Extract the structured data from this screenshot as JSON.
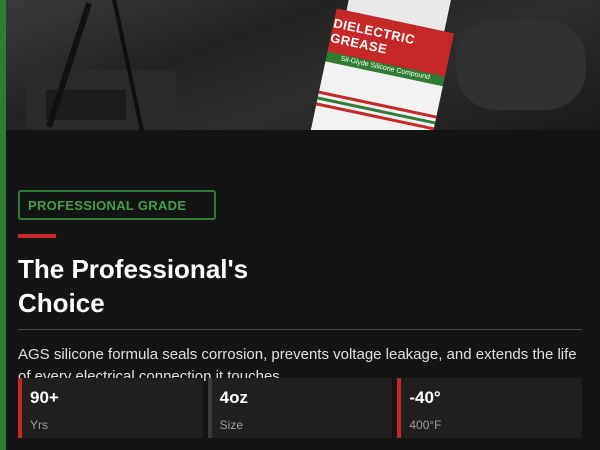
{
  "hero": {
    "product_label": "DIELECTRIC GREASE",
    "product_sublabel": "Sil-Glyde Silicone Compound"
  },
  "badge": {
    "label": "PROFESSIONAL GRADE"
  },
  "heading": {
    "line1": "The Professional's",
    "line2": "Choice"
  },
  "description": "AGS silicone formula seals corrosion, prevents voltage leakage, and extends the life of every electrical connection it touches.",
  "stats": [
    {
      "value": "90+",
      "label": "Yrs"
    },
    {
      "value": "4oz",
      "label": "Size"
    },
    {
      "value": "-40°",
      "label": "400°F"
    }
  ],
  "colors": {
    "background": "#141414",
    "accent_green": "#2e7d32",
    "accent_red": "#c62828"
  }
}
